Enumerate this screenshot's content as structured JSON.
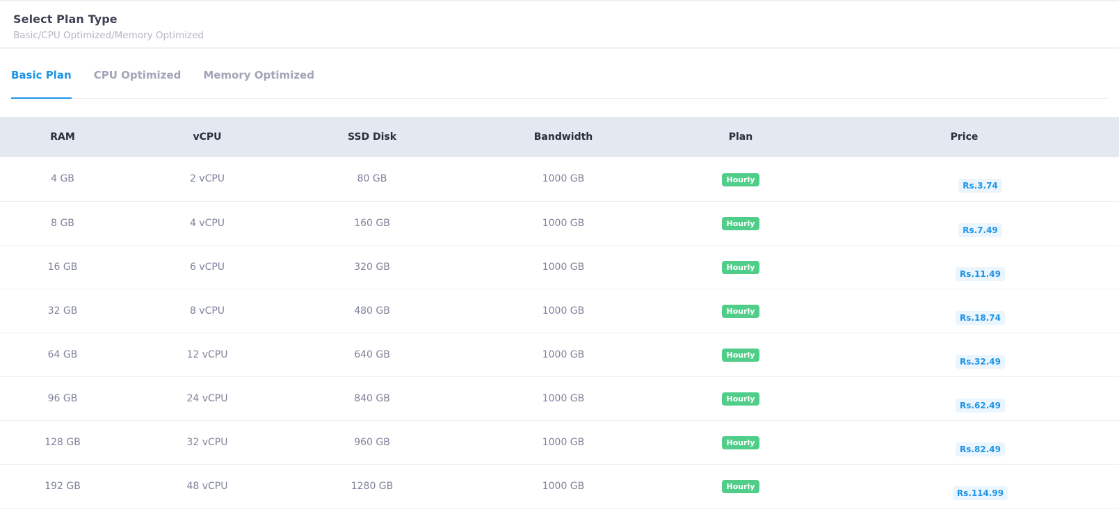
{
  "header": {
    "title": "Select Plan Type",
    "subtitle": "Basic/CPU Optimized/Memory Optimized"
  },
  "tabs": [
    {
      "label": "Basic Plan",
      "active": true
    },
    {
      "label": "CPU Optimized",
      "active": false
    },
    {
      "label": "Memory Optimized",
      "active": false
    }
  ],
  "table": {
    "columns": [
      "RAM",
      "vCPU",
      "SSD Disk",
      "Bandwidth",
      "Plan",
      "Price"
    ],
    "rows": [
      {
        "ram": "4 GB",
        "vcpu": "2 vCPU",
        "ssd": "80 GB",
        "bandwidth": "1000 GB",
        "plan": "Hourly",
        "price": "Rs.3.74"
      },
      {
        "ram": "8 GB",
        "vcpu": "4 vCPU",
        "ssd": "160 GB",
        "bandwidth": "1000 GB",
        "plan": "Hourly",
        "price": "Rs.7.49"
      },
      {
        "ram": "16 GB",
        "vcpu": "6 vCPU",
        "ssd": "320 GB",
        "bandwidth": "1000 GB",
        "plan": "Hourly",
        "price": "Rs.11.49"
      },
      {
        "ram": "32 GB",
        "vcpu": "8 vCPU",
        "ssd": "480 GB",
        "bandwidth": "1000 GB",
        "plan": "Hourly",
        "price": "Rs.18.74"
      },
      {
        "ram": "64 GB",
        "vcpu": "12 vCPU",
        "ssd": "640 GB",
        "bandwidth": "1000 GB",
        "plan": "Hourly",
        "price": "Rs.32.49"
      },
      {
        "ram": "96 GB",
        "vcpu": "24 vCPU",
        "ssd": "840 GB",
        "bandwidth": "1000 GB",
        "plan": "Hourly",
        "price": "Rs.62.49"
      },
      {
        "ram": "128 GB",
        "vcpu": "32 vCPU",
        "ssd": "960 GB",
        "bandwidth": "1000 GB",
        "plan": "Hourly",
        "price": "Rs.82.49"
      },
      {
        "ram": "192 GB",
        "vcpu": "48 vCPU",
        "ssd": "1280 GB",
        "bandwidth": "1000 GB",
        "plan": "Hourly",
        "price": "Rs.114.99"
      }
    ]
  },
  "colors": {
    "accent": "#1e94e6",
    "plan_badge": "#50cd89",
    "header_bg": "#e4e8f1"
  }
}
